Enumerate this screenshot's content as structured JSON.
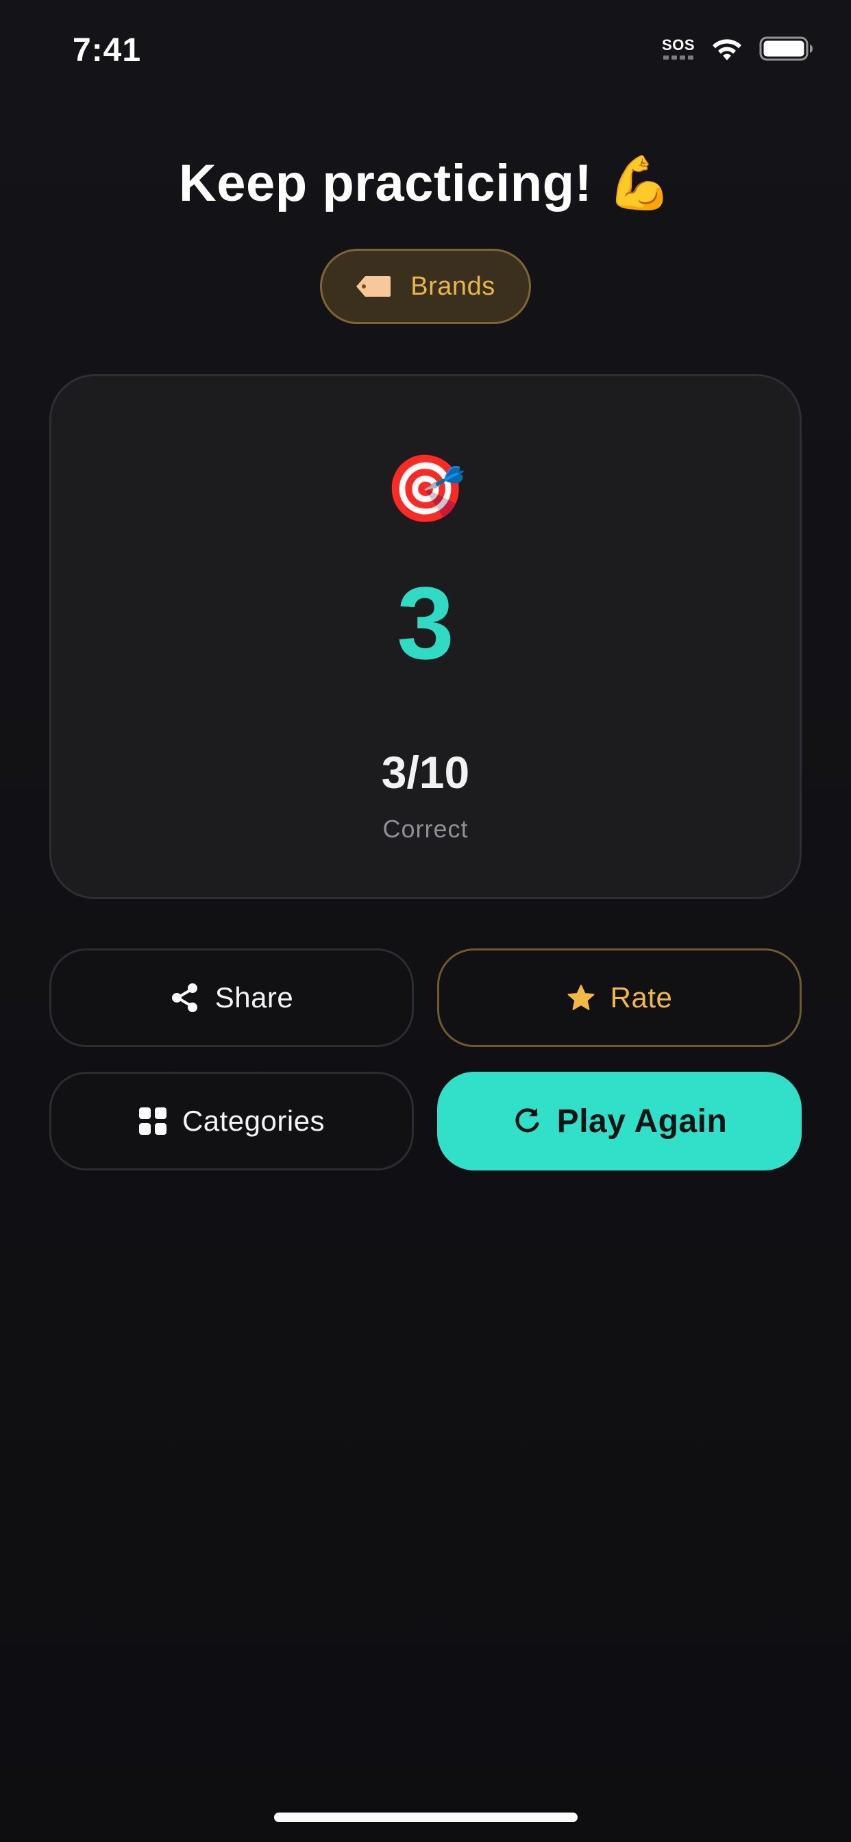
{
  "status_bar": {
    "time": "7:41",
    "sos": "SOS",
    "icons": [
      "sos-icon",
      "wifi-icon",
      "battery-icon"
    ]
  },
  "header": {
    "title": "Keep practicing! 💪",
    "category": {
      "icon": "tag-icon",
      "label": "Brands"
    }
  },
  "result": {
    "emoji": "🎯",
    "score": "3",
    "fraction": "3/10",
    "caption": "Correct"
  },
  "actions": {
    "share": {
      "label": "Share",
      "icon": "share-icon"
    },
    "rate": {
      "label": "Rate",
      "icon": "star-icon"
    },
    "categories": {
      "label": "Categories",
      "icon": "grid-icon"
    },
    "play_again": {
      "label": "Play Again",
      "icon": "refresh-icon"
    }
  },
  "colors": {
    "background": "#141418",
    "accent": "#30e0c9",
    "gold": "#f1b942",
    "card": "#1c1c1f",
    "muted_text": "#8e8e94"
  }
}
